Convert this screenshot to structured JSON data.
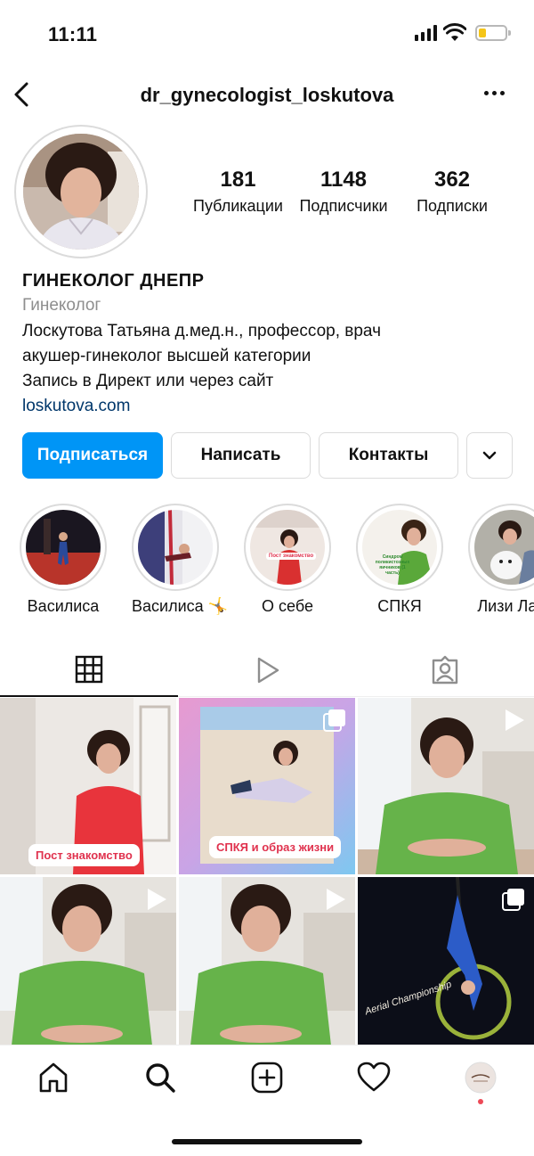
{
  "status_bar": {
    "time": "11:11"
  },
  "header": {
    "username": "dr_gynecologist_loskutova"
  },
  "profile": {
    "stats": [
      {
        "value": "181",
        "label": "Публикации"
      },
      {
        "value": "1148",
        "label": "Подписчики"
      },
      {
        "value": "362",
        "label": "Подписки"
      }
    ],
    "name": "ГИНЕКОЛОГ ДНЕПР",
    "category": "Гинеколог",
    "bio_lines": [
      "Лоскутова Татьяна д.мед.н., профессор, врач",
      "акушер-гинеколог высшей категории",
      "Запись в Директ или через сайт"
    ],
    "website": "loskutova.com"
  },
  "actions": {
    "follow": "Подписаться",
    "message": "Написать",
    "contacts": "Контакты"
  },
  "highlights": [
    {
      "label": "Василиса"
    },
    {
      "label": "Василиса 🤸"
    },
    {
      "label": "О себе",
      "overlay": "Пост знакомство"
    },
    {
      "label": "СПКЯ",
      "overlay": "Синдром поликистозных яичников (1 часть)"
    },
    {
      "label": "Лизи Лаб"
    }
  ],
  "posts": [
    {
      "caption": "Пост знакомство",
      "type": "photo"
    },
    {
      "caption": "СПКЯ и образ жизни",
      "type": "carousel"
    },
    {
      "type": "reel"
    },
    {
      "type": "reel"
    },
    {
      "type": "reel"
    },
    {
      "type": "carousel",
      "overlay": "Aerial Championship"
    }
  ],
  "colors": {
    "primary": "#0095f6",
    "link": "#00376b",
    "muted": "#8e8e8e",
    "caption": "#e0324e"
  }
}
